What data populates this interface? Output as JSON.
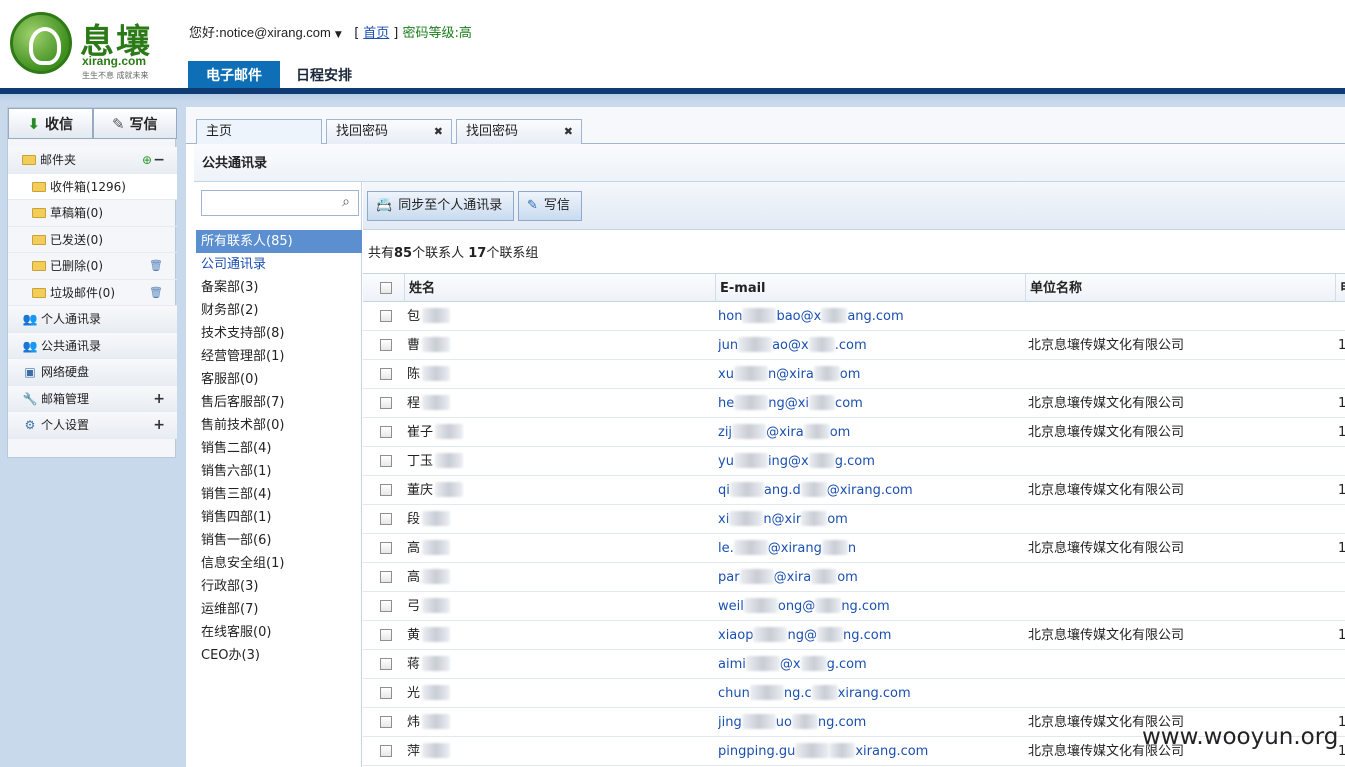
{
  "header": {
    "logo_cn": "息壤",
    "logo_en": "xirang.com",
    "logo_slogan": "生生不息 成就未来",
    "greeting_prefix": "您好:",
    "user_email": "notice@xirang.com",
    "bracket_open": "[",
    "home_link": "首页",
    "bracket_close": "]",
    "security_level": "密码等级:高",
    "nav": {
      "email": "电子邮件",
      "schedule": "日程安排"
    }
  },
  "sidebar": {
    "receive": "收信",
    "write": "写信",
    "folders_label": "邮件夹",
    "folders": [
      {
        "label": "收件箱(1296)"
      },
      {
        "label": "草稿箱(0)"
      },
      {
        "label": "已发送(0)"
      },
      {
        "label": "已删除(0)"
      },
      {
        "label": "垃圾邮件(0)"
      }
    ],
    "personal_contacts": "个人通讯录",
    "public_contacts": "公共通讯录",
    "net_disk": "网络硬盘",
    "mailbox_mgmt": "邮箱管理",
    "personal_settings": "个人设置"
  },
  "tabs": [
    {
      "label": "主页"
    },
    {
      "label": "找回密码"
    },
    {
      "label": "找回密码"
    }
  ],
  "panel_title": "公共通讯录",
  "search": {
    "placeholder": ""
  },
  "groups": [
    {
      "label": "所有联系人(85)"
    },
    {
      "label": "公司通讯录"
    },
    {
      "label": "备案部(3)"
    },
    {
      "label": "财务部(2)"
    },
    {
      "label": "技术支持部(8)"
    },
    {
      "label": "经营管理部(1)"
    },
    {
      "label": "客服部(0)"
    },
    {
      "label": "售后客服部(7)"
    },
    {
      "label": "售前技术部(0)"
    },
    {
      "label": "销售二部(4)"
    },
    {
      "label": "销售六部(1)"
    },
    {
      "label": "销售三部(4)"
    },
    {
      "label": "销售四部(1)"
    },
    {
      "label": "销售一部(6)"
    },
    {
      "label": "信息安全组(1)"
    },
    {
      "label": "行政部(3)"
    },
    {
      "label": "运维部(7)"
    },
    {
      "label": "在线客服(0)"
    },
    {
      "label": "CEO办(3)"
    }
  ],
  "toolbar": {
    "sync": "同步至个人通讯录",
    "write": "写信"
  },
  "summary": {
    "prefix": "共有",
    "contacts": "85",
    "mid": "个联系人 ",
    "groups": "17",
    "suffix": "个联系组"
  },
  "table": {
    "columns": {
      "name": "姓名",
      "email": "E-mail",
      "org": "单位名称",
      "extra": "电"
    },
    "rows": [
      {
        "name": "包",
        "email_a": "hon",
        "email_b": "bao@x",
        "email_c": "ang.com",
        "org": "",
        "extra": ""
      },
      {
        "name": "曹",
        "email_a": "jun",
        "email_b": "ao@x",
        "email_c": ".com",
        "org": "北京息壤传媒文化有限公司",
        "extra": "1"
      },
      {
        "name": "陈",
        "email_a": "xu",
        "email_b": "n@xira",
        "email_c": "om",
        "org": "",
        "extra": ""
      },
      {
        "name": "程",
        "email_a": "he",
        "email_b": "ng@xi",
        "email_c": "com",
        "org": "北京息壤传媒文化有限公司",
        "extra": "1"
      },
      {
        "name": "崔子",
        "email_a": "zij",
        "email_b": "@xira",
        "email_c": "om",
        "org": "北京息壤传媒文化有限公司",
        "extra": "1"
      },
      {
        "name": "丁玉",
        "email_a": "yu",
        "email_b": "ing@x",
        "email_c": "g.com",
        "org": "",
        "extra": ""
      },
      {
        "name": "董庆",
        "email_a": "qi",
        "email_b": "ang.d",
        "email_c": "@xirang.com",
        "org": "北京息壤传媒文化有限公司",
        "extra": "1"
      },
      {
        "name": "段",
        "email_a": "xi",
        "email_b": "n@xir",
        "email_c": "om",
        "org": "",
        "extra": ""
      },
      {
        "name": "高",
        "email_a": "le.",
        "email_b": "@xirang",
        "email_c": "n",
        "org": "北京息壤传媒文化有限公司",
        "extra": "1"
      },
      {
        "name": "高",
        "email_a": "par",
        "email_b": "@xira",
        "email_c": "om",
        "org": "",
        "extra": ""
      },
      {
        "name": "弓",
        "email_a": "weil",
        "email_b": "ong@",
        "email_c": "ng.com",
        "org": "",
        "extra": ""
      },
      {
        "name": "黄",
        "email_a": "xiaop",
        "email_b": "ng@",
        "email_c": "ng.com",
        "org": "北京息壤传媒文化有限公司",
        "extra": "1"
      },
      {
        "name": "蒋",
        "email_a": "aimi",
        "email_b": "@x",
        "email_c": "g.com",
        "org": "",
        "extra": ""
      },
      {
        "name": "光",
        "email_a": "chun",
        "email_b": "ng.c",
        "email_c": "xirang.com",
        "org": "",
        "extra": ""
      },
      {
        "name": "炜",
        "email_a": "jing",
        "email_b": "uo",
        "email_c": "ng.com",
        "org": "北京息壤传媒文化有限公司",
        "extra": "1"
      },
      {
        "name": "萍",
        "email_a": "pingping.gu",
        "email_b": "",
        "email_c": "xirang.com",
        "org": "北京息壤传媒文化有限公司",
        "extra": "1"
      }
    ]
  },
  "watermark": "www.wooyun.org"
}
